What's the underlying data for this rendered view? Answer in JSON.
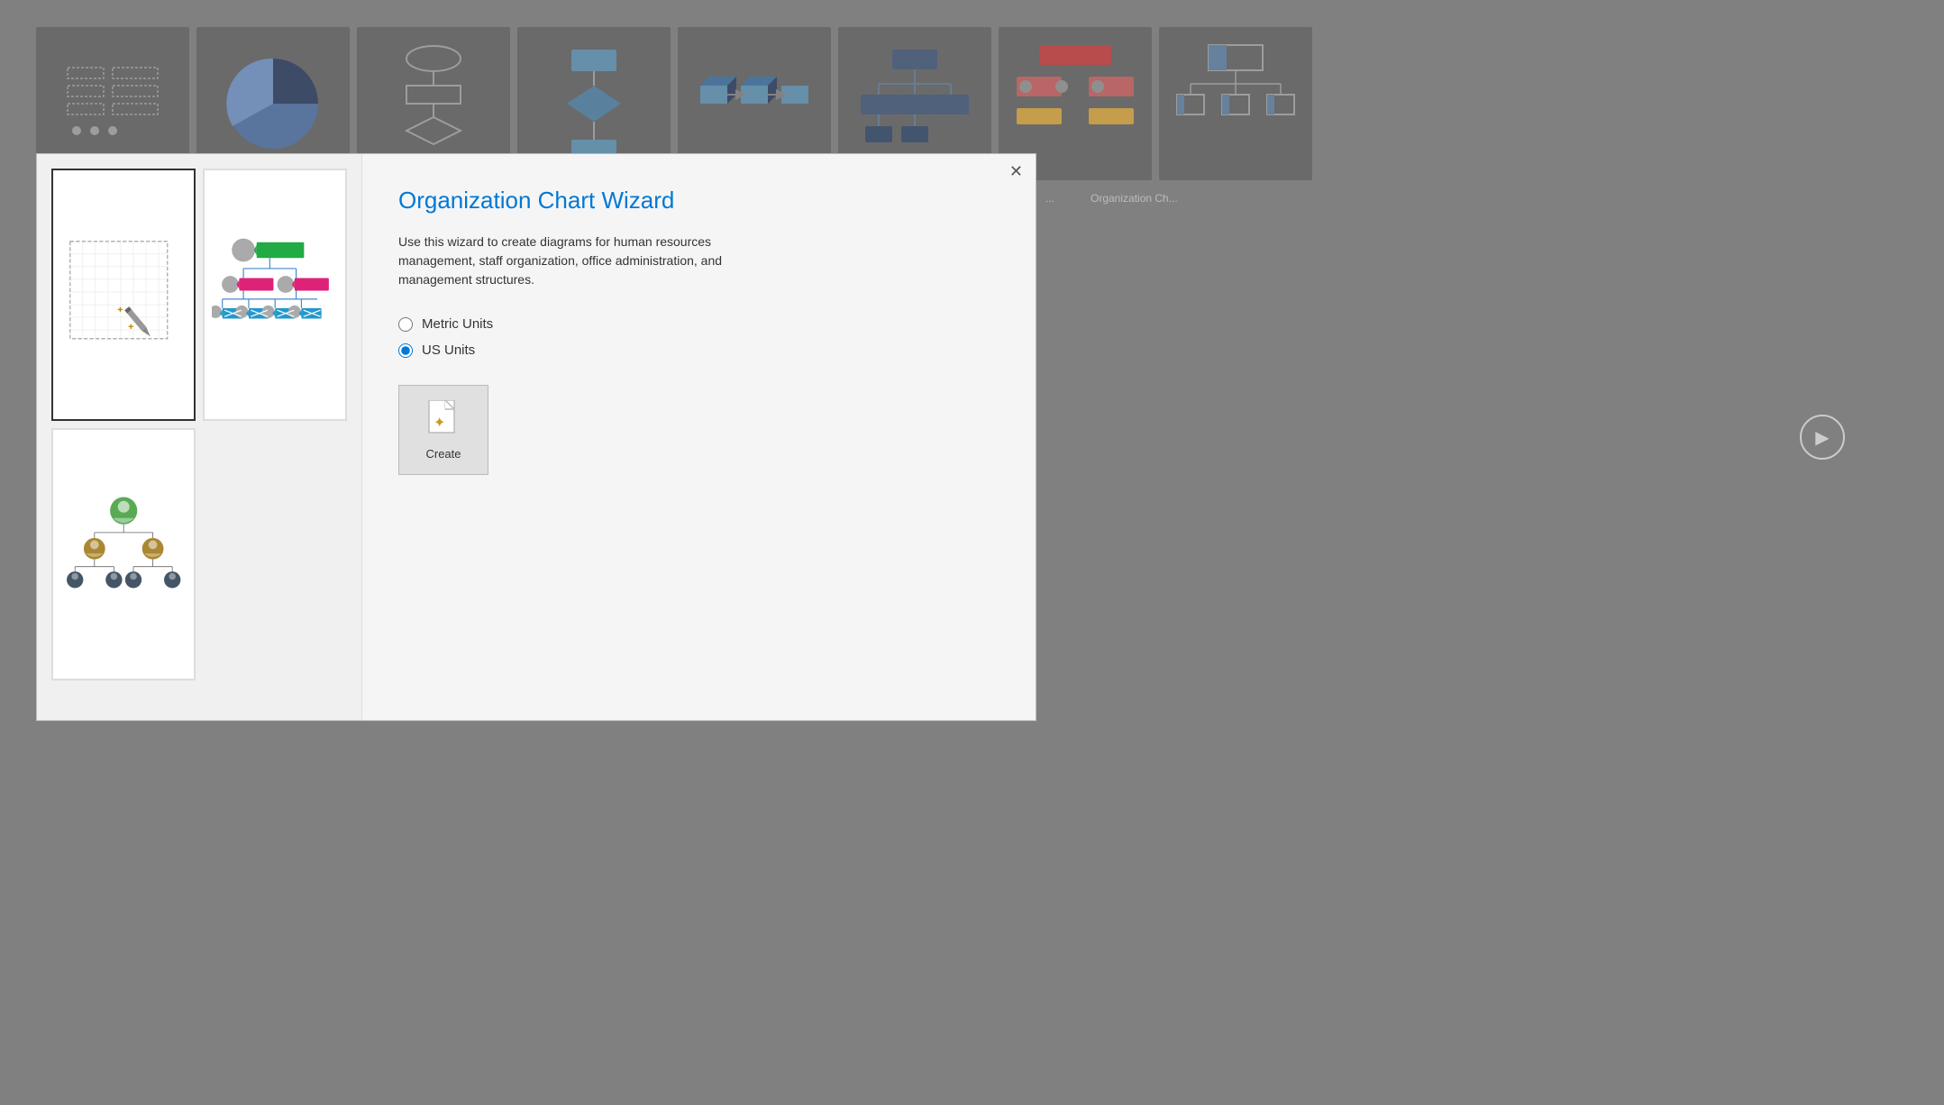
{
  "background": {
    "thumbnails": [
      {
        "id": "thumb1",
        "type": "flowchart-simple"
      },
      {
        "id": "thumb2",
        "type": "pie-chart"
      },
      {
        "id": "thumb3",
        "type": "flowchart-oval"
      },
      {
        "id": "thumb4",
        "type": "flowchart-diamond"
      },
      {
        "id": "thumb5",
        "type": "network"
      },
      {
        "id": "thumb6",
        "type": "org-dark"
      },
      {
        "id": "thumb7",
        "type": "org-color"
      },
      {
        "id": "thumb8",
        "type": "org-box"
      }
    ],
    "labels": [
      "...",
      "Organization Ch..."
    ],
    "play_button_label": "▶"
  },
  "modal": {
    "close_button_label": "✕",
    "title": "Organization Chart Wizard",
    "description": "Use this wizard to create diagrams for human resources management, staff organization, office administration, and management structures.",
    "radio_options": [
      {
        "id": "metric",
        "label": "Metric Units",
        "checked": false
      },
      {
        "id": "us",
        "label": "US Units",
        "checked": true
      }
    ],
    "create_button_label": "Create"
  }
}
